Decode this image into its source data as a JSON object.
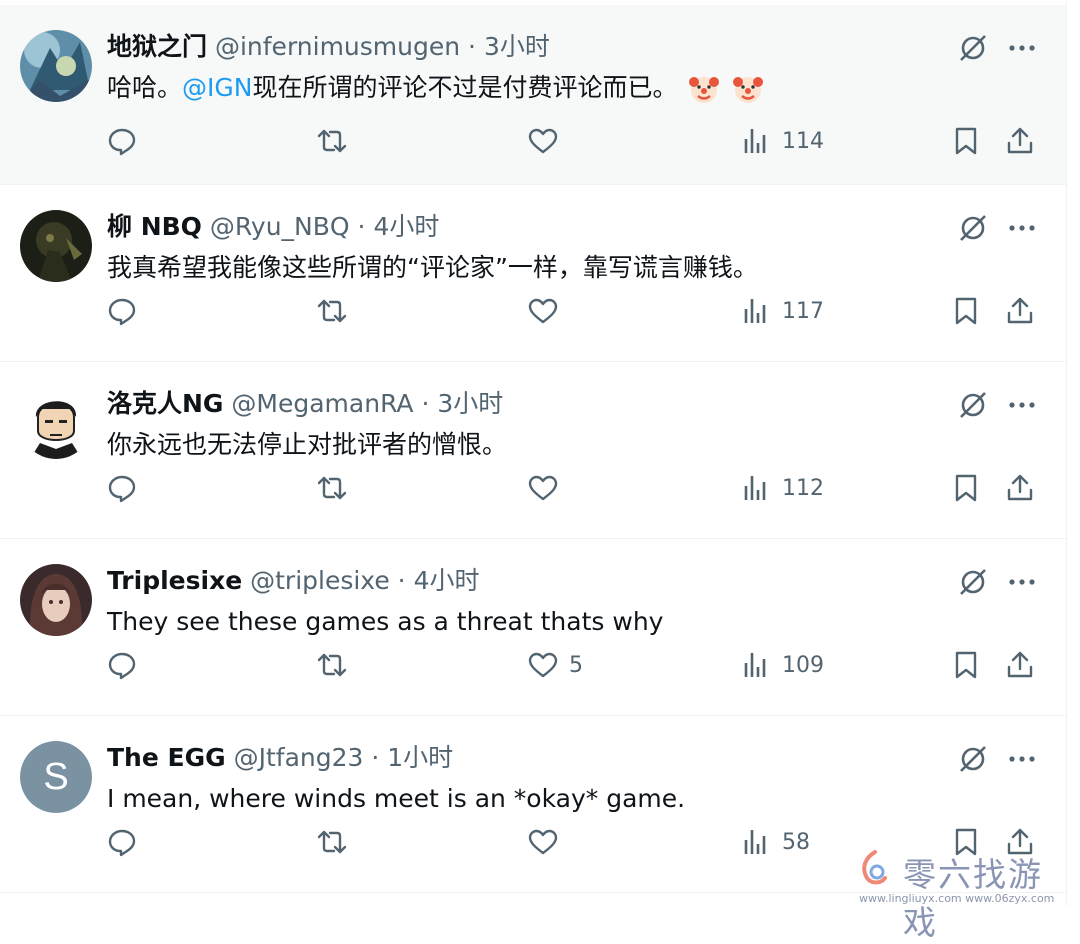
{
  "tweets": [
    {
      "name": "地狱之门",
      "handle": "@infernimusmugen",
      "sep": "·",
      "time": "3小时",
      "text_before": "哈哈。",
      "mention": "@IGN",
      "text_after": "现在所谓的评论不过是付费评论而已。",
      "emoji": [
        "clown-face",
        "clown-face"
      ],
      "likes": "",
      "views": "114",
      "highlighted": true,
      "avatar": "art"
    },
    {
      "name": "柳 NBQ",
      "handle": "@Ryu_NBQ",
      "sep": "·",
      "time": "4小时",
      "text_before": "我真希望我能像这些所谓的“评论家”一样，靠写谎言赚钱。",
      "likes": "",
      "views": "117",
      "avatar": "art"
    },
    {
      "name": "洛克人NG",
      "handle": "@MegamanRA",
      "sep": "·",
      "time": "3小时",
      "text_before": "你永远也无法停止对批评者的憎恨。",
      "likes": "",
      "views": "112",
      "avatar": "art"
    },
    {
      "name": "Triplesixe",
      "handle": "@triplesixe",
      "sep": "·",
      "time": "4小时",
      "text_before": "They see these games as a threat thats why",
      "likes": "5",
      "views": "109",
      "avatar": "art"
    },
    {
      "name": "The EGG",
      "handle": "@Jtfang23",
      "sep": "·",
      "time": "1小时",
      "text_before": "I mean, where winds meet is an *okay* game.",
      "likes": "",
      "views": "58",
      "avatar": "letter",
      "avatar_letter": "S"
    }
  ],
  "icons": {
    "reply": "reply-icon",
    "retweet": "retweet-icon",
    "like": "heart-icon",
    "views": "views-icon",
    "bookmark": "bookmark-icon",
    "share": "share-icon",
    "grok": "grok-icon",
    "more": "more-icon"
  },
  "colors": {
    "text": "#0f1419",
    "secondary": "#536471",
    "mention": "#1d9bf0",
    "highlight_bg": "#f7f9f9"
  },
  "watermark": {
    "brand": "零六找游戏",
    "urls": "www.lingliuyx.com  www.06zyx.com"
  }
}
